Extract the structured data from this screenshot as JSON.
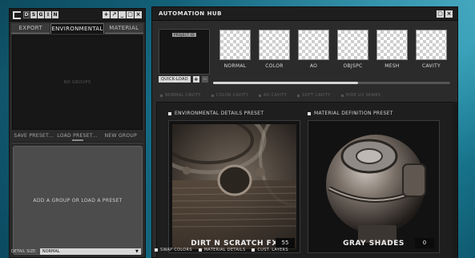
{
  "left_panel": {
    "logo_letters": [
      "D",
      "S",
      "G",
      "I",
      "N"
    ],
    "window_buttons": [
      "+",
      "↗",
      "_",
      "▢",
      "×"
    ],
    "tabs": [
      {
        "label": "EXPORT",
        "active": false
      },
      {
        "label": "ENVIRONMENTAL",
        "active": true
      },
      {
        "label": "MATERIAL",
        "active": false
      }
    ],
    "groups_empty_text": "NO GROUPS",
    "actions": [
      "SAVE PRESET...",
      "LOAD PRESET...",
      "NEW GROUP"
    ],
    "dropzone_text": "ADD A GROUP OR LOAD A PRESET"
  },
  "hub": {
    "title": "AUTOMATION HUB",
    "window_buttons": [
      "▢",
      "×"
    ],
    "preview_label": "PROJECT ID",
    "maps": [
      "NORMAL",
      "COLOR",
      "AO",
      "OBJSPC",
      "MESH",
      "CAVITY"
    ],
    "quickload_label": "QUICK-LOAD",
    "plus": "+",
    "minus": "−",
    "quickload_progress": 0.61,
    "options": [
      "NORMAL CAVITY",
      "COLOR CAVITY",
      "AO CAVITY",
      "SOFT CAVITY",
      "HIDE UV SEAMS"
    ],
    "env_section_title": "ENVIRONMENTAL DETAILS PRESET",
    "mat_section_title": "MATERIAL DEFINITION PRESET",
    "env_card": {
      "name": "DIRT N SCRATCH FX",
      "count": "55"
    },
    "mat_card": {
      "name": "GRAY SHADES",
      "count": "0"
    },
    "detail_size_label": "DETAIL SIZE:",
    "detail_size_value": "NORMAL",
    "toggles": [
      "SWAP COLORS",
      "MATERIAL DETAILS",
      "CUST. LAYERS"
    ]
  }
}
